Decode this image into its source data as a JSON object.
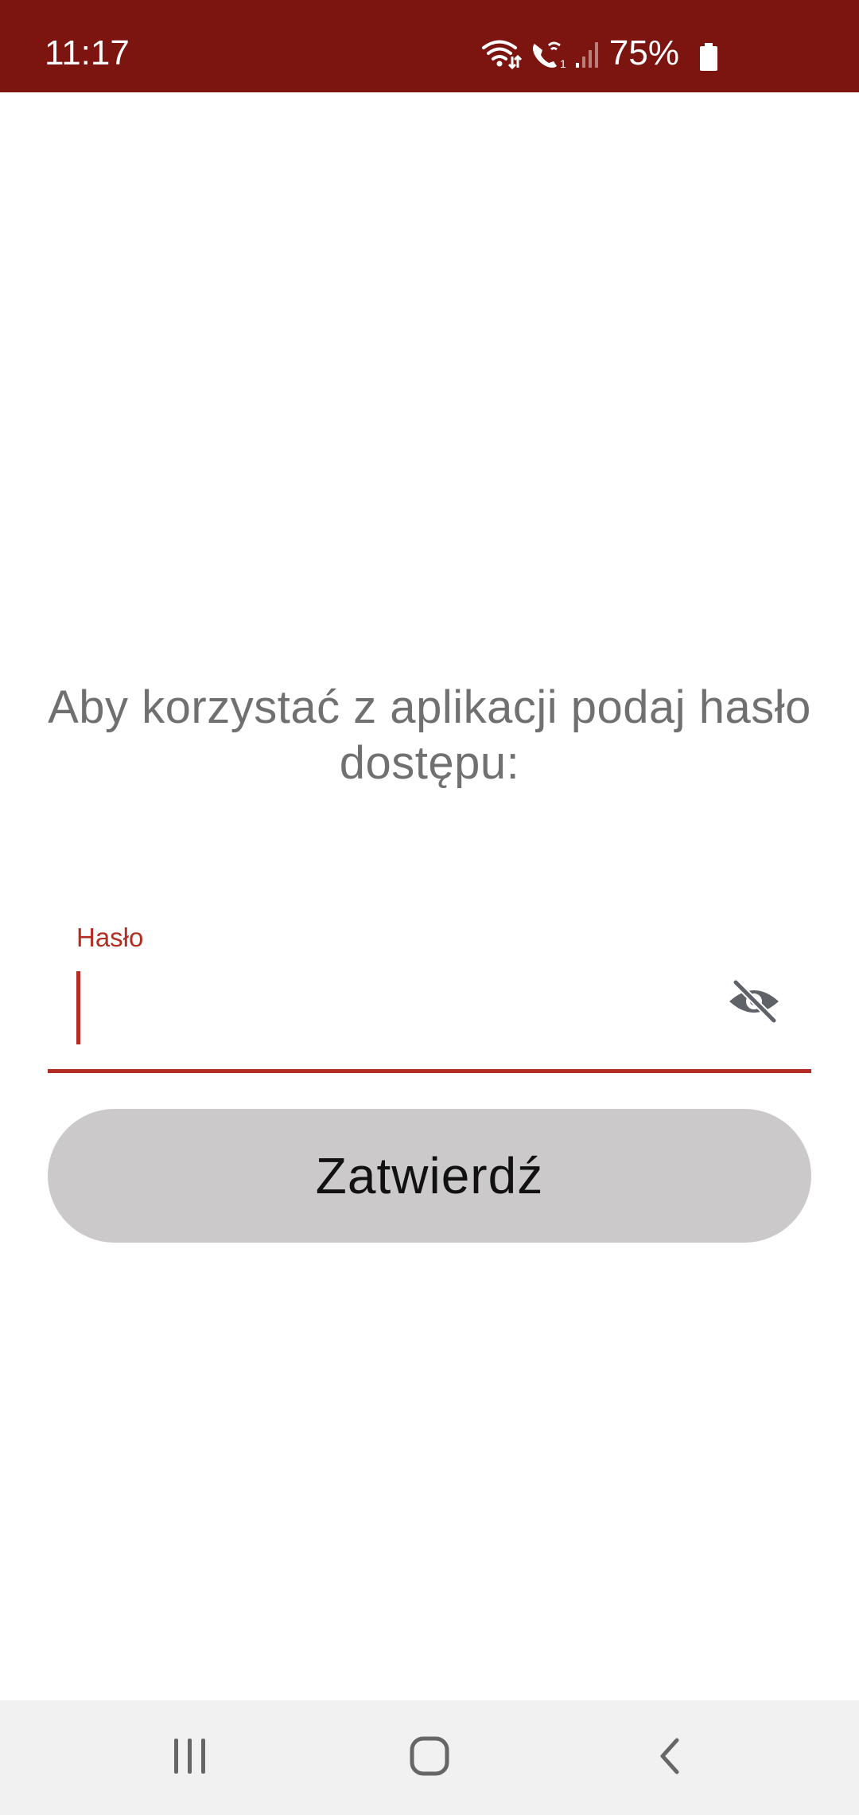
{
  "status_bar": {
    "time": "11:17",
    "battery_percent": "75%",
    "icons": [
      "wifi-icon",
      "wifi-call-icon",
      "signal-icon",
      "battery-icon"
    ],
    "background": "#7c1410"
  },
  "login": {
    "prompt": "Aby korzystać z aplikacji podaj hasło dostępu:",
    "password_label": "Hasło",
    "password_value": "",
    "visibility_icon": "eye-off-icon",
    "submit_label": "Zatwierdź",
    "accent_color": "#b32d22"
  },
  "nav_bar": {
    "buttons": [
      "recent-apps-icon",
      "home-icon",
      "back-icon"
    ]
  }
}
